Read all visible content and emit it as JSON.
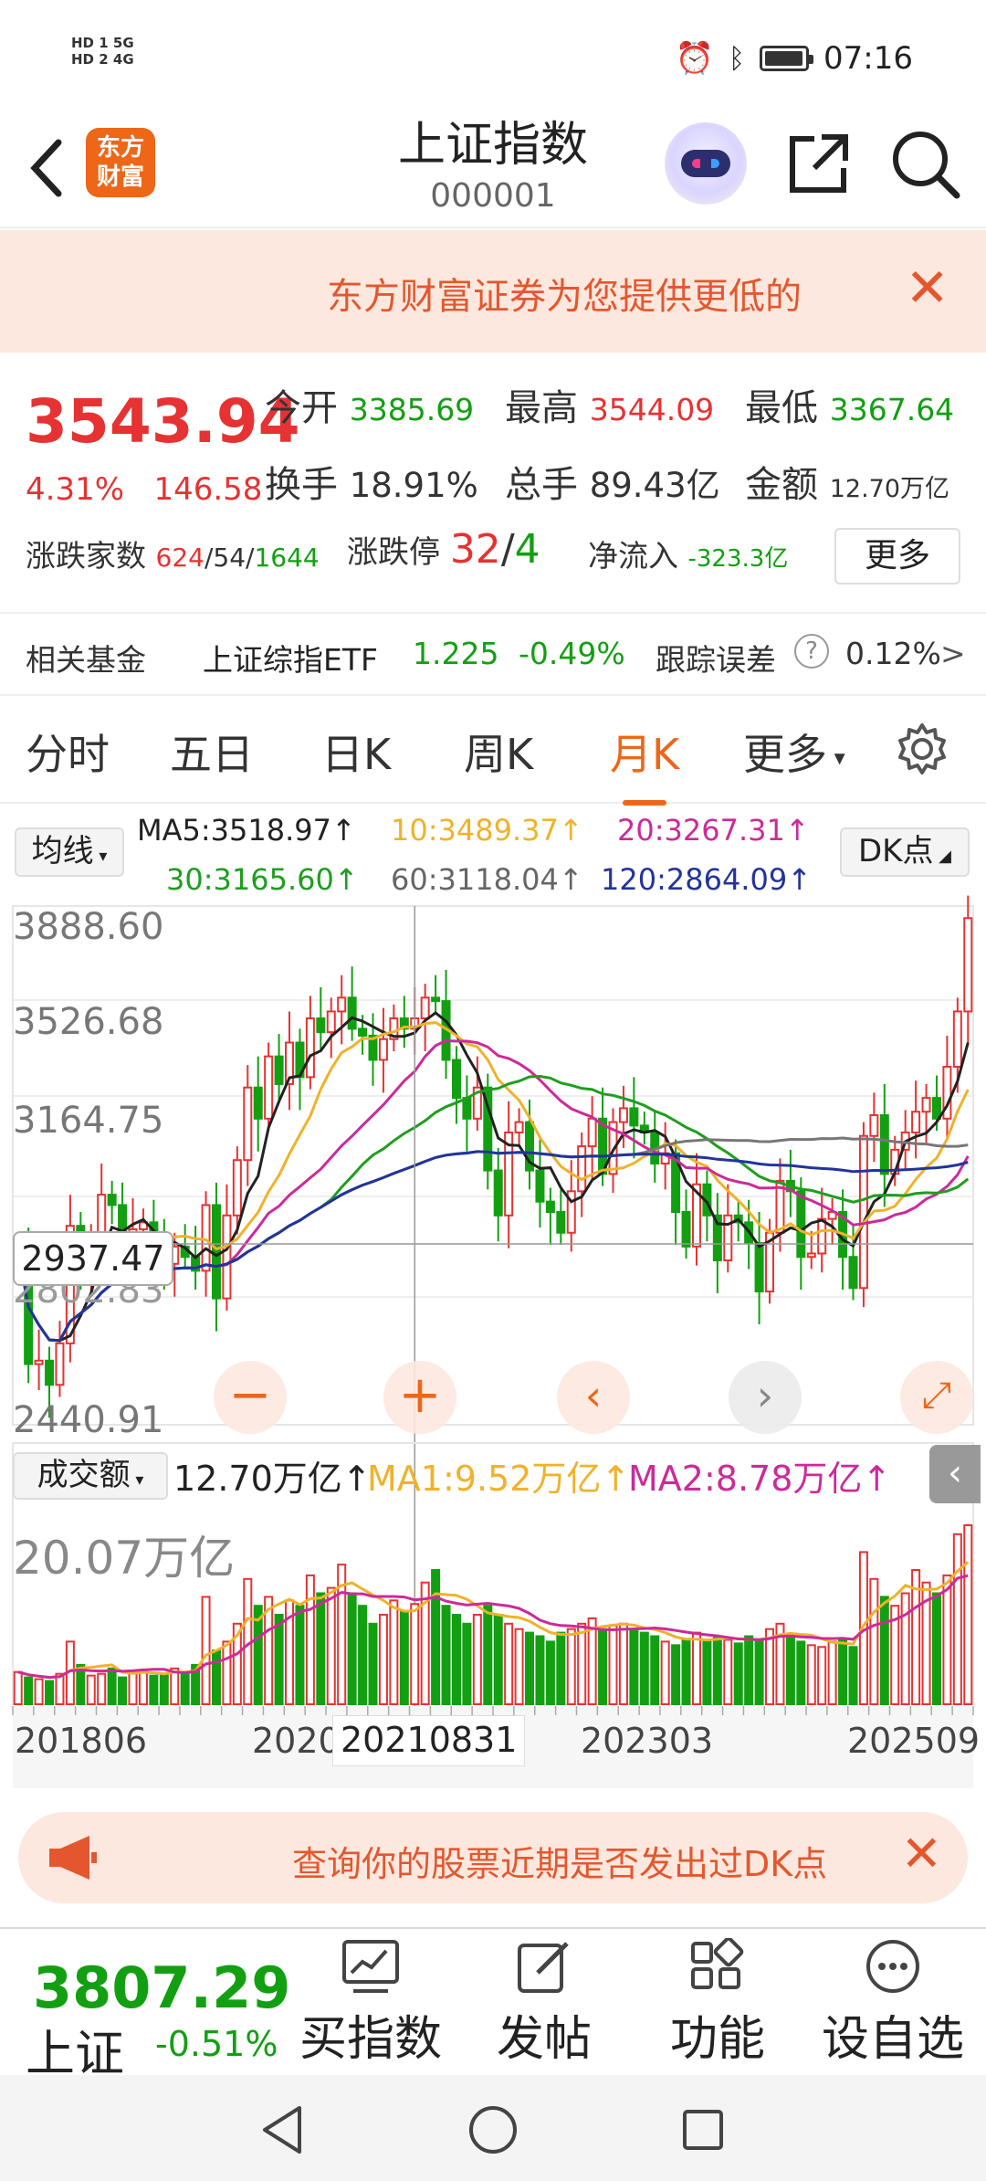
{
  "status_bar": {
    "sim1": "HD 1 5G",
    "sim2": "HD 2 4G",
    "time": "07:16"
  },
  "header": {
    "title": "上证指数",
    "code": "000001",
    "logo_line1": "东方",
    "logo_line2": "财富"
  },
  "promo_banner": {
    "text": "东方财富证券为您提供更低的"
  },
  "quote": {
    "price": "3543.94",
    "change_pct": "4.31%",
    "change_abs": "146.58",
    "open_label": "今开",
    "open": "3385.69",
    "high_label": "最高",
    "high": "3544.09",
    "low_label": "最低",
    "low": "3367.64",
    "turnover_label": "换手",
    "turnover": "18.91%",
    "volume_label": "总手",
    "volume": "89.43亿",
    "amount_label": "金额",
    "amount": "12.70万亿",
    "breadth_label": "涨跌家数",
    "breadth_up": "624",
    "breadth_flat": "54",
    "breadth_down": "1644",
    "limit_label": "涨跌停",
    "limit_up": "32",
    "limit_down": "4",
    "netflow_label": "净流入",
    "netflow": "-323.3亿",
    "more_label": "更多"
  },
  "fund": {
    "label": "相关基金",
    "name": "上证综指ETF",
    "price": "1.225",
    "change": "-0.49%",
    "track_label": "跟踪误差",
    "track_value": "0.12%",
    "arrow": ">"
  },
  "tabs": [
    {
      "label": "分时"
    },
    {
      "label": "五日"
    },
    {
      "label": "日K"
    },
    {
      "label": "周K"
    },
    {
      "label": "月K"
    },
    {
      "label": "更多"
    }
  ],
  "ma": {
    "selector": "均线",
    "ma5": "MA5:3518.97↑",
    "ma10": "10:3489.37↑",
    "ma20": "20:3267.31↑",
    "ma30": "30:3165.60↑",
    "ma60": "60:3118.04↑",
    "ma120": "120:2864.09↑",
    "dk": "DK点"
  },
  "chart_data": {
    "type": "candlestick",
    "y_labels": [
      "3888.60",
      "3526.68",
      "3164.75",
      "2802.83",
      "2440.91"
    ],
    "crosshair_value": "2937.47",
    "x_labels": [
      "201806",
      "2020",
      "20210831",
      "202303",
      "202509"
    ],
    "volume_selector": "成交额",
    "volume_value": "12.70万亿↑",
    "vol_ma1": "MA1:9.52万亿↑",
    "vol_ma2": "MA2:8.78万亿↑",
    "volume_max": "20.07万亿",
    "colors": {
      "up": "#e63232",
      "down": "#12a012",
      "ma5": "#222222",
      "ma10": "#f0b22a",
      "ma20": "#cc2a9a",
      "ma30": "#1f9e1f",
      "ma60": "#777777",
      "ma120": "#22349b"
    },
    "closes": [
      2920,
      2590,
      2600,
      2530,
      2650,
      2990,
      2880,
      2930,
      3080,
      3050,
      2930,
      2980,
      3000,
      2920,
      2880,
      2930,
      2900,
      2860,
      3050,
      2780,
      3020,
      3180,
      3390,
      3300,
      3480,
      3400,
      3520,
      3420,
      3590,
      3550,
      3610,
      3650,
      3560,
      3540,
      3470,
      3530,
      3590,
      3560,
      3590,
      3650,
      3640,
      3470,
      3360,
      3300,
      3390,
      3150,
      3020,
      3260,
      3290,
      3150,
      3060,
      3030,
      2970,
      3090,
      3220,
      3300,
      3140,
      3290,
      3330,
      3280,
      3260,
      3170,
      3200,
      3030,
      2930,
      3110,
      3020,
      2890,
      3020,
      3000,
      2940,
      2800,
      2970,
      3120,
      3090,
      2900,
      2910,
      3010,
      3030,
      2900,
      2810,
      3250,
      3310,
      3140,
      3210,
      3260,
      3320,
      3360,
      3300,
      3450,
      3610,
      3880
    ],
    "volume_ratio": [
      0.18,
      0.15,
      0.14,
      0.13,
      0.17,
      0.35,
      0.22,
      0.16,
      0.17,
      0.2,
      0.15,
      0.18,
      0.19,
      0.16,
      0.17,
      0.2,
      0.18,
      0.22,
      0.6,
      0.3,
      0.35,
      0.45,
      0.7,
      0.55,
      0.6,
      0.5,
      0.58,
      0.55,
      0.72,
      0.62,
      0.65,
      0.78,
      0.62,
      0.55,
      0.45,
      0.5,
      0.58,
      0.52,
      0.56,
      0.68,
      0.75,
      0.55,
      0.5,
      0.45,
      0.5,
      0.55,
      0.5,
      0.45,
      0.42,
      0.4,
      0.38,
      0.35,
      0.4,
      0.42,
      0.45,
      0.48,
      0.42,
      0.44,
      0.45,
      0.42,
      0.4,
      0.38,
      0.35,
      0.33,
      0.36,
      0.4,
      0.35,
      0.38,
      0.36,
      0.34,
      0.38,
      0.35,
      0.42,
      0.45,
      0.38,
      0.35,
      0.33,
      0.32,
      0.35,
      0.36,
      0.32,
      0.85,
      0.7,
      0.6,
      0.55,
      0.62,
      0.75,
      0.68,
      0.62,
      0.72,
      0.95,
      1.0
    ]
  },
  "action_banner": {
    "text": "查询你的股票近期是否发出过DK点"
  },
  "bottom_bar": {
    "index_value": "3807.29",
    "index_name": "上证",
    "index_change": "-0.51%",
    "buy_label": "买指数",
    "post_label": "发帖",
    "func_label": "功能",
    "watch_label": "设自选"
  }
}
